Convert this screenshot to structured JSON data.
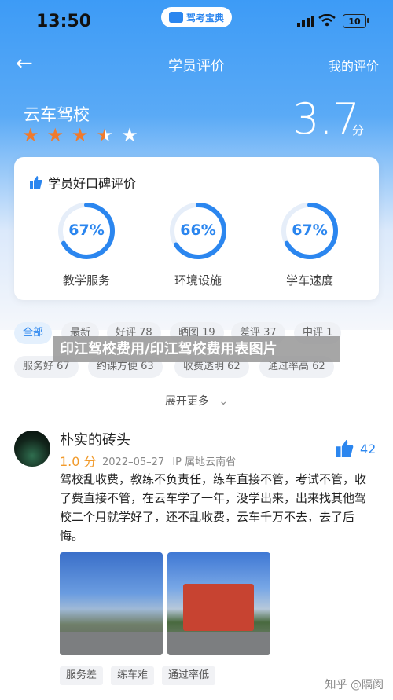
{
  "status_bar": {
    "time": "13:50",
    "app_pill": "驾考宝典",
    "battery": "10"
  },
  "nav": {
    "back_icon": "back-arrow-icon",
    "title": "学员评价",
    "my_reviews": "我的评价"
  },
  "school": {
    "name": "云车驾校",
    "stars": 3.5,
    "max_stars": 5,
    "score": "3.7",
    "unit": "分"
  },
  "card": {
    "title": "学员好口碑评价",
    "gauges": [
      {
        "value": 67,
        "text": "67%",
        "label": "教学服务"
      },
      {
        "value": 66,
        "text": "66%",
        "label": "环境设施"
      },
      {
        "value": 67,
        "text": "67%",
        "label": "学车速度"
      }
    ]
  },
  "tags": {
    "row1": [
      "全部",
      "最新",
      "好评 78",
      "晒图 19",
      "差评 37",
      "中评 1"
    ],
    "row2": [
      "服务好 67",
      "约课方便 63",
      "收费透明 62",
      "通过率高 62"
    ]
  },
  "banner": "印江驾校费用/印江驾校费用表图片",
  "expand_label": "展开更多",
  "review": {
    "author": "朴实的砖头",
    "rating": "1.0 分",
    "date": "2022–05–27",
    "location": "IP 属地云南省",
    "likes": "42",
    "content": "驾校乱收费，教练不负责任，练车直接不管，考试不管，收了费直接不管，在云车学了一年，没学出来，出来找其他驾校二个月就学好了，还不乱收费，云车千万不去，去了后悔。",
    "tags": [
      "服务差",
      "练车难",
      "通过率低"
    ]
  },
  "watermark": "知乎 @隔阂",
  "colors": {
    "accent": "#2b86ef",
    "star": "#f07a2c",
    "rating": "#f19a2b"
  }
}
